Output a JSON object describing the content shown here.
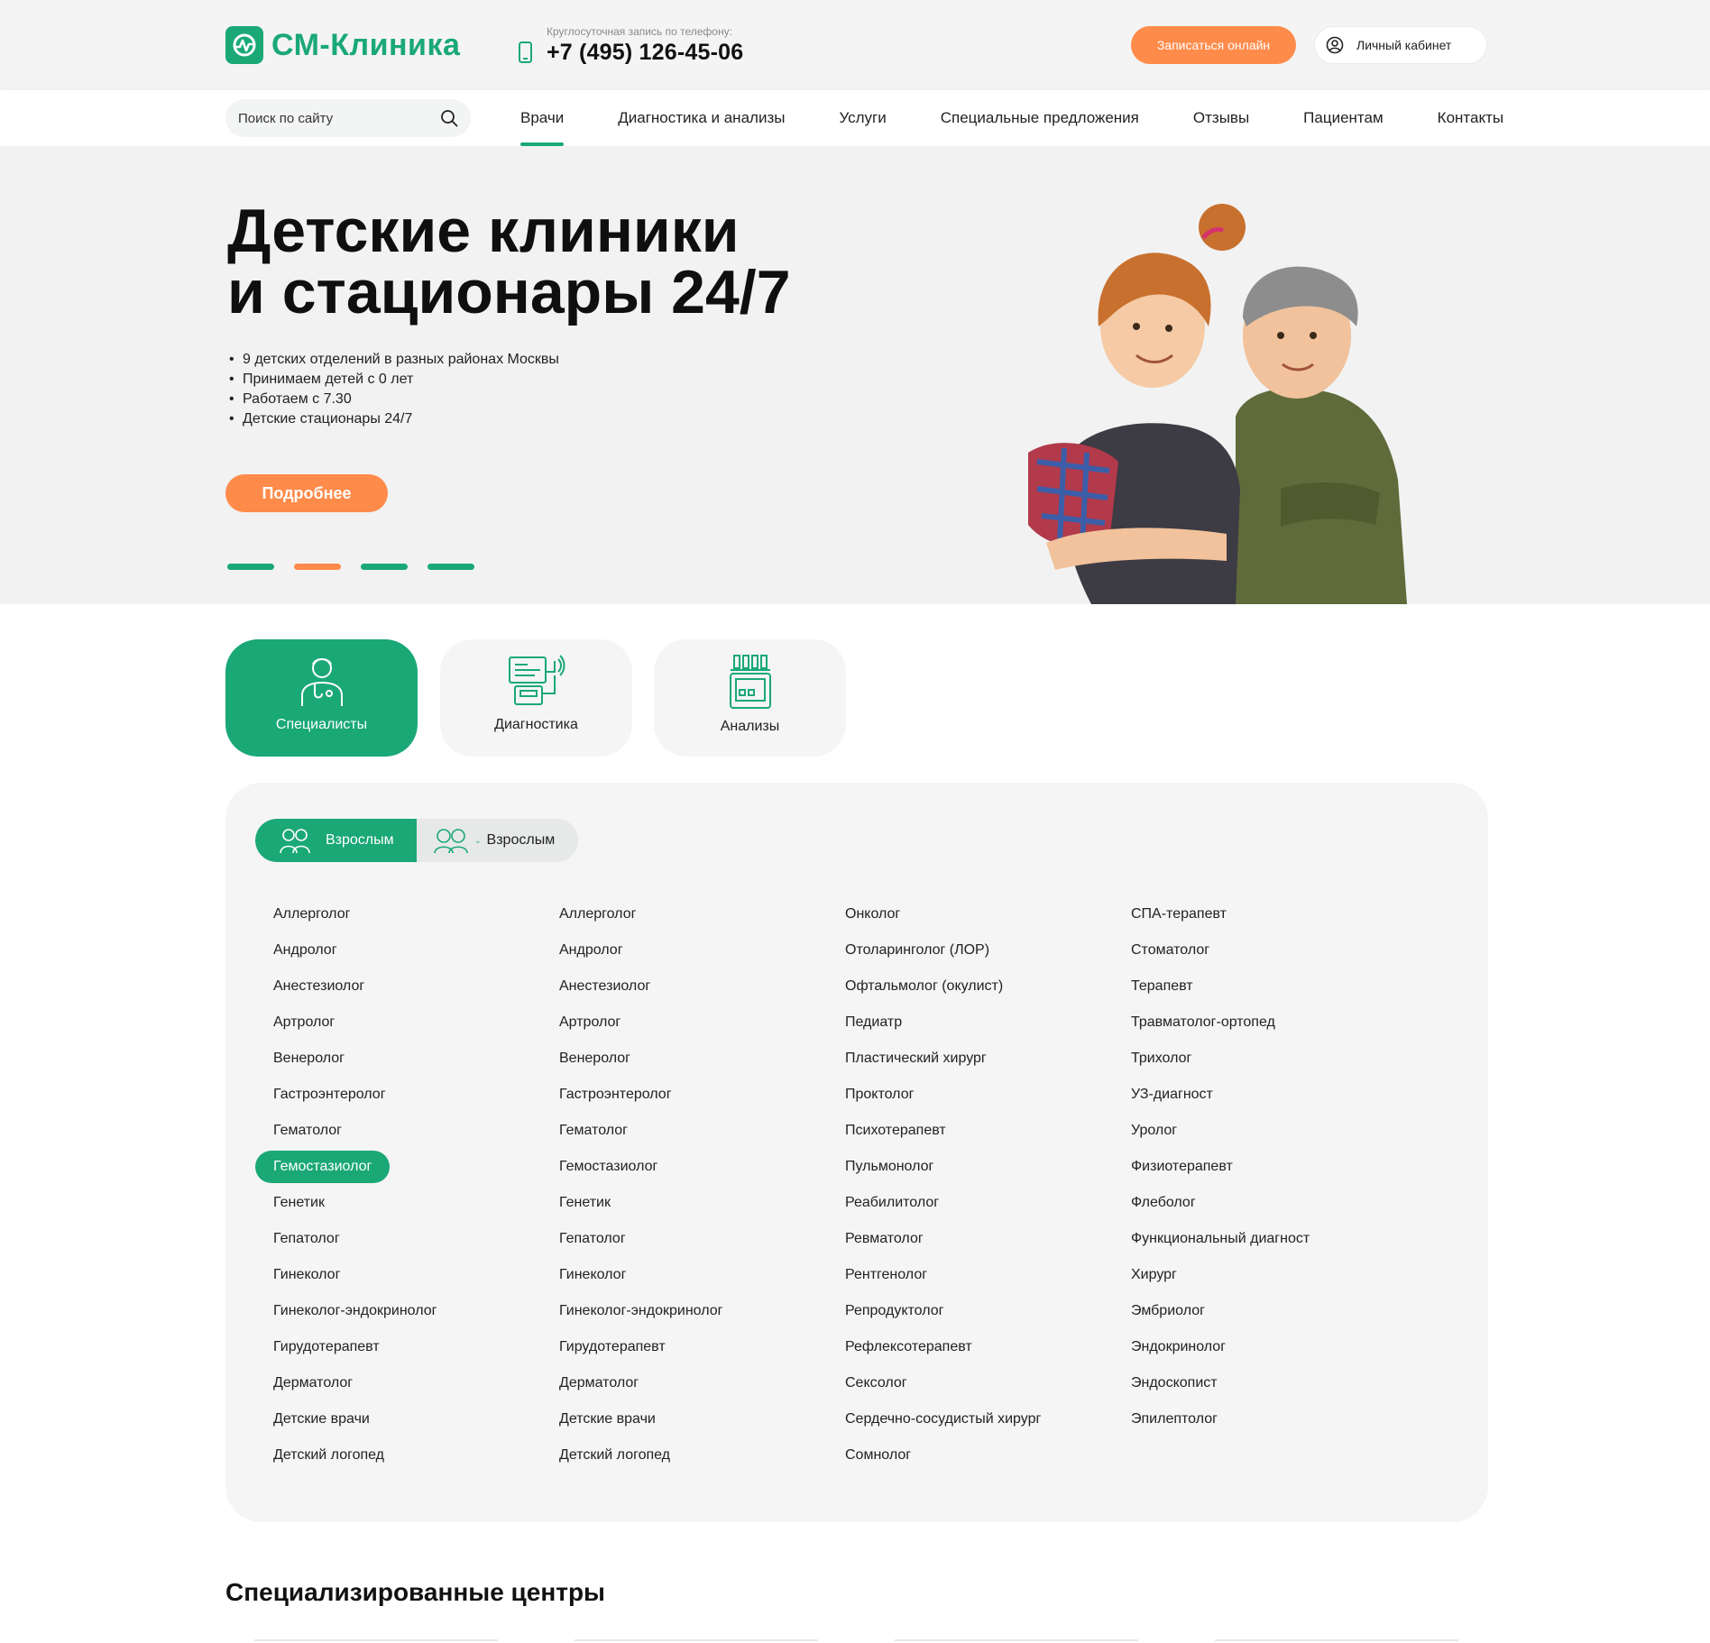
{
  "header": {
    "logo_text": "СМ-Клиника",
    "phone_caption": "Круглосуточная запись по телефону:",
    "phone_number": "+7 (495) 126-45-06",
    "book_online_label": "Записаться онлайн",
    "cabinet_label": "Личный кабинет"
  },
  "nav": {
    "search_placeholder": "Поиск по сайту",
    "items": [
      {
        "label": "Врачи",
        "active": true
      },
      {
        "label": "Диагностика и анализы"
      },
      {
        "label": "Услуги"
      },
      {
        "label": "Специальные предложения"
      },
      {
        "label": "Отзывы"
      },
      {
        "label": "Пациентам"
      },
      {
        "label": "Контакты"
      }
    ]
  },
  "hero": {
    "title_line1": "Детские клиники",
    "title_line2": "и стационары 24/7",
    "bullets": [
      "9 детских отделений в разных районах Москвы",
      "Принимаем детей с 0 лет",
      "Работаем с 7.30",
      "Детские стационары 24/7"
    ],
    "more_label": "Подробнее",
    "slides_total": 4,
    "active_slide": 2
  },
  "categories": [
    {
      "label": "Специалисты",
      "icon": "doctor-icon",
      "active": true
    },
    {
      "label": "Диагностика",
      "icon": "diagnostics-monitor-icon"
    },
    {
      "label": "Анализы",
      "icon": "lab-analyzer-icon"
    }
  ],
  "audience_toggle": {
    "adults_label": "Взрослым",
    "second_label": "Взрослым"
  },
  "specialists": {
    "col1": [
      "Аллерголог",
      "Андролог",
      "Анестезиолог",
      "Артролог",
      "Венеролог",
      "Гастроэнтеролог",
      "Гематолог",
      "Гемостазиолог",
      "Генетик",
      "Гепатолог",
      "Гинеколог",
      "Гинеколог-эндокринолог",
      "Гирудотерапевт",
      "Дерматолог",
      "Детские врачи",
      "Детский логопед"
    ],
    "col2": [
      "Аллерголог",
      "Андролог",
      "Анестезиолог",
      "Артролог",
      "Венеролог",
      "Гастроэнтеролог",
      "Гематолог",
      "Гемостазиолог",
      "Генетик",
      "Гепатолог",
      "Гинеколог",
      "Гинеколог-эндокринолог",
      "Гирудотерапевт",
      "Дерматолог",
      "Детские врачи",
      "Детский логопед"
    ],
    "col3": [
      "Онколог",
      "Отоларинголог (ЛОР)",
      "Офтальмолог (окулист)",
      "Педиатр",
      "Пластический хирург",
      "Проктолог",
      "Психотерапевт",
      "Пульмонолог",
      "Реабилитолог",
      "Ревматолог",
      "Рентгенолог",
      "Репродуктолог",
      "Рефлексотерапевт",
      "Сексолог",
      "Сердечно-сосудистый хирург",
      "Сомнолог"
    ],
    "col4": [
      "СПА-терапевт",
      "Стоматолог",
      "Терапевт",
      "Травматолог-ортопед",
      "Трихолог",
      "УЗ-диагност",
      "Уролог",
      "Физиотерапевт",
      "Флеболог",
      "Функциональный диагност",
      "Хирург",
      "Эмбриолог",
      "Эндокринолог",
      "Эндоскопист",
      "Эпилептолог"
    ],
    "selected": "Гемостазиолог"
  },
  "section": {
    "title": "Специализированные центры"
  },
  "colors": {
    "brand_green": "#1aa876",
    "accent_orange": "#ff8b4a",
    "panel_bg": "#f4f5f4"
  }
}
